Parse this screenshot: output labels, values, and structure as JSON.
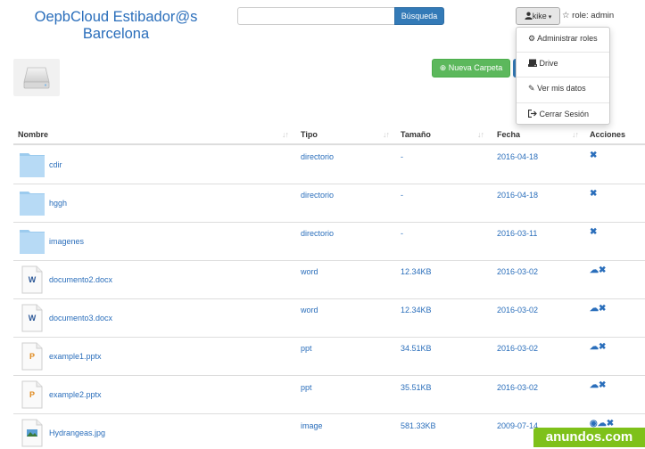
{
  "header": {
    "title": "OepbCloud Estibador@s Barcelona",
    "search_button": "Búsqueda",
    "search_placeholder": "",
    "user_button": "kike",
    "role_text": "role: admin"
  },
  "user_menu": {
    "items": [
      {
        "label": "Administrar roles",
        "icon": "gear-icon"
      },
      {
        "label": "Drive",
        "icon": "hdd-icon"
      },
      {
        "label": "Ver mis datos",
        "icon": "pencil-icon"
      },
      {
        "label": "Cerrar Sesión",
        "icon": "logout-icon"
      }
    ]
  },
  "toolbar": {
    "new_folder": "Nueva Carpeta"
  },
  "table": {
    "headers": {
      "name": "Nombre",
      "type": "Tipo",
      "size": "Tamaño",
      "date": "Fecha",
      "actions": "Acciones"
    },
    "rows": [
      {
        "name": "cdir",
        "type": "directorio",
        "size": "-",
        "date": "2016-04-18",
        "icon": "folder-icon",
        "actions": [
          "delete"
        ]
      },
      {
        "name": "hggh",
        "type": "directorio",
        "size": "-",
        "date": "2016-04-18",
        "icon": "folder-icon",
        "actions": [
          "delete"
        ]
      },
      {
        "name": "imagenes",
        "type": "directorio",
        "size": "-",
        "date": "2016-03-11",
        "icon": "folder-icon",
        "actions": [
          "delete"
        ]
      },
      {
        "name": "documento2.docx",
        "type": "word",
        "size": "12.34KB",
        "date": "2016-03-02",
        "icon": "word-file-icon",
        "actions": [
          "download",
          "delete"
        ]
      },
      {
        "name": "documento3.docx",
        "type": "word",
        "size": "12.34KB",
        "date": "2016-03-02",
        "icon": "word-file-icon",
        "actions": [
          "download",
          "delete"
        ]
      },
      {
        "name": "example1.pptx",
        "type": "ppt",
        "size": "34.51KB",
        "date": "2016-03-02",
        "icon": "ppt-file-icon",
        "actions": [
          "download",
          "delete"
        ]
      },
      {
        "name": "example2.pptx",
        "type": "ppt",
        "size": "35.51KB",
        "date": "2016-03-02",
        "icon": "ppt-file-icon",
        "actions": [
          "download",
          "delete"
        ]
      },
      {
        "name": "Hydrangeas.jpg",
        "type": "image",
        "size": "581.33KB",
        "date": "2009-07-14",
        "icon": "image-file-icon",
        "actions": [
          "view",
          "download",
          "delete"
        ]
      }
    ]
  },
  "watermark": "anundos.com",
  "colors": {
    "link": "#2a6ebb",
    "primary": "#337ab7",
    "success": "#5cb85c",
    "watermark": "#7ec11a"
  }
}
